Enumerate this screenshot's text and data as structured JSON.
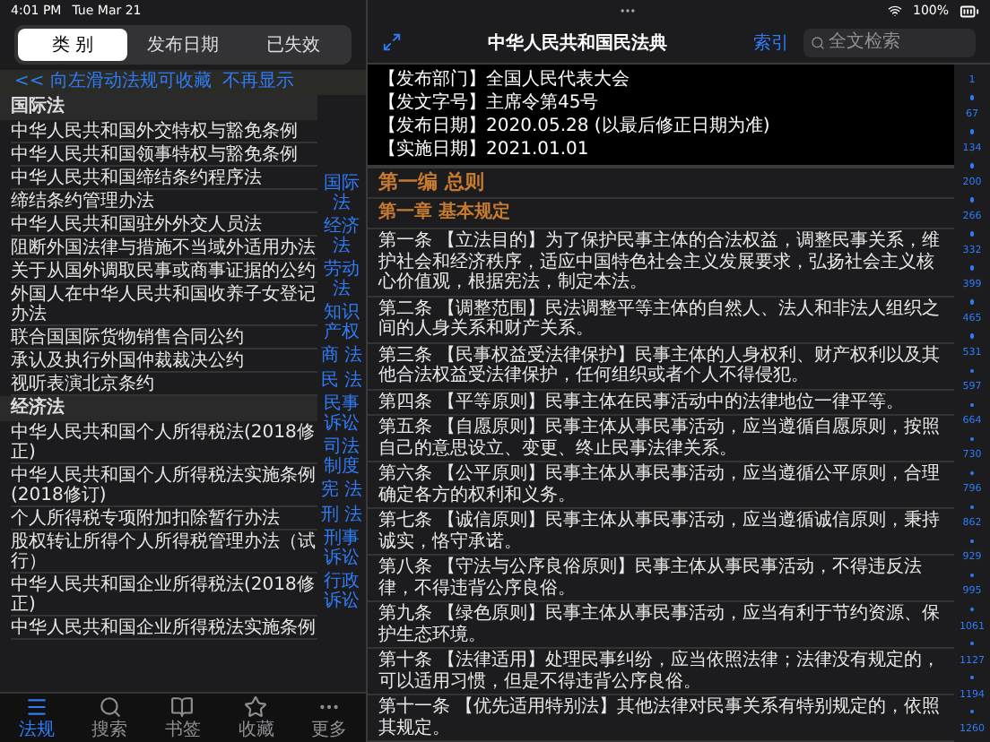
{
  "status_bar": {
    "time": "4:01 PM",
    "date": "Tue Mar 21",
    "battery": "100%"
  },
  "sidebar": {
    "segments": [
      {
        "label": "类 别",
        "selected": true
      },
      {
        "label": "发布日期",
        "selected": false
      },
      {
        "label": "已失效",
        "selected": false
      }
    ],
    "notice": {
      "text": "<< 向左滑动法规可收藏",
      "dismiss": "不再显示"
    },
    "sections": [
      {
        "title": "国际法",
        "items": [
          "中华人民共和国外交特权与豁免条例",
          "中华人民共和国领事特权与豁免条例",
          "中华人民共和国缔结条约程序法",
          "缔结条约管理办法",
          "中华人民共和国驻外外交人员法",
          "阻断外国法律与措施不当域外适用办法",
          "关于从国外调取民事或商事证据的公约",
          "外国人在中华人民共和国收养子女登记办法",
          "联合国国际货物销售合同公约",
          "承认及执行外国仲裁裁决公约",
          "视听表演北京条约"
        ]
      },
      {
        "title": "经济法",
        "items": [
          "中华人民共和国个人所得税法(2018修正)",
          "中华人民共和国个人所得税法实施条例(2018修订)",
          "个人所得税专项附加扣除暂行办法",
          "股权转让所得个人所得税管理办法（试行）",
          "中华人民共和国企业所得税法(2018修正)",
          "中华人民共和国企业所得税法实施条例"
        ]
      }
    ],
    "index": [
      "国际法",
      "经济法",
      "劳动法",
      "知识产权",
      "商 法",
      "民 法",
      "民事诉讼",
      "司法制度",
      "宪 法",
      "刑 法",
      "刑事诉讼",
      "行政诉讼"
    ]
  },
  "tab_bar": [
    {
      "label": "法规",
      "selected": true
    },
    {
      "label": "搜索",
      "selected": false
    },
    {
      "label": "书签",
      "selected": false
    },
    {
      "label": "收藏",
      "selected": false
    },
    {
      "label": "更多",
      "selected": false
    }
  ],
  "document": {
    "title": "中华人民共和国民法典",
    "index_link": "索引",
    "search": {
      "placeholder": "全文检索"
    },
    "meta": [
      "【发布部门】全国人民代表大会",
      "【发文字号】主席令第45号",
      "【发布日期】2020.05.28 (以最后修正日期为准)",
      "【实施日期】2021.01.01"
    ],
    "blocks": [
      {
        "kind": "part",
        "text": "第一编 总则"
      },
      {
        "kind": "chapter",
        "text": "第一章 基本规定"
      },
      {
        "kind": "article",
        "text": "第一条 【立法目的】为了保护民事主体的合法权益，调整民事关系，维护社会和经济秩序，适应中国特色社会主义发展要求，弘扬社会主义核心价值观，根据宪法，制定本法。"
      },
      {
        "kind": "article",
        "text": "第二条 【调整范围】民法调整平等主体的自然人、法人和非法人组织之间的人身关系和财产关系。"
      },
      {
        "kind": "article",
        "text": "第三条 【民事权益受法律保护】民事主体的人身权利、财产权利以及其他合法权益受法律保护，任何组织或者个人不得侵犯。"
      },
      {
        "kind": "article",
        "text": "第四条 【平等原则】民事主体在民事活动中的法律地位一律平等。"
      },
      {
        "kind": "article",
        "text": "第五条 【自愿原则】民事主体从事民事活动，应当遵循自愿原则，按照自己的意思设立、变更、终止民事法律关系。"
      },
      {
        "kind": "article",
        "text": "第六条 【公平原则】民事主体从事民事活动，应当遵循公平原则，合理确定各方的权利和义务。"
      },
      {
        "kind": "article",
        "text": "第七条 【诚信原则】民事主体从事民事活动，应当遵循诚信原则，秉持诚实，恪守承诺。"
      },
      {
        "kind": "article",
        "text": "第八条 【守法与公序良俗原则】民事主体从事民事活动，不得违反法律，不得违背公序良俗。"
      },
      {
        "kind": "article",
        "text": "第九条 【绿色原则】民事主体从事民事活动，应当有利于节约资源、保护生态环境。"
      },
      {
        "kind": "article",
        "text": "第十条 【法律适用】处理民事纠纷，应当依照法律；法律没有规定的，可以适用习惯，但是不得违背公序良俗。"
      },
      {
        "kind": "article",
        "text": "第十一条 【优先适用特别法】其他法律对民事关系有特别规定的，依照其规定。"
      }
    ],
    "index": [
      "1",
      "67",
      "134",
      "200",
      "266",
      "332",
      "399",
      "465",
      "531",
      "597",
      "664",
      "730",
      "796",
      "862",
      "929",
      "995",
      "1061",
      "1127",
      "1194",
      "1260"
    ]
  }
}
